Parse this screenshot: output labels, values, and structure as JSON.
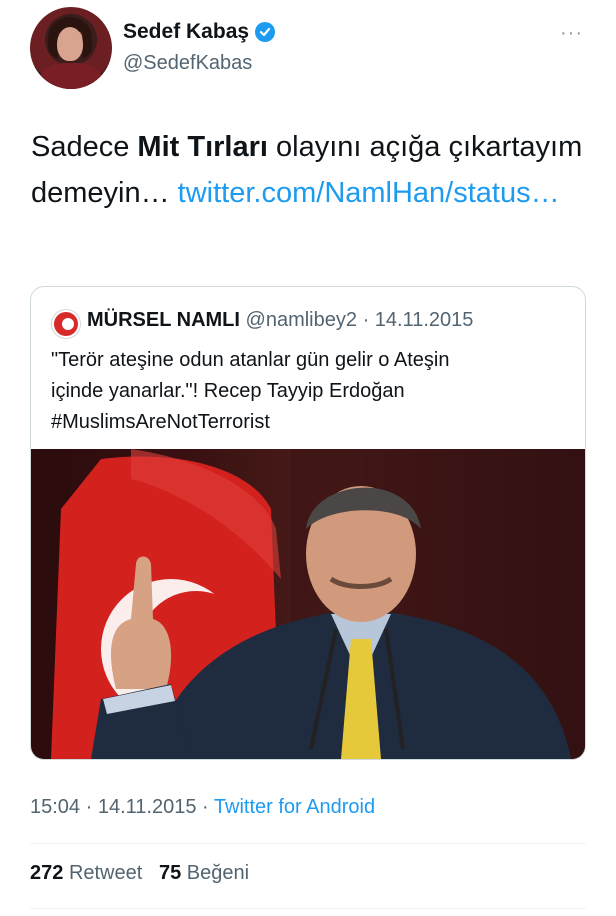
{
  "author": {
    "display_name": "Sedef Kabaş",
    "handle": "@SedefKabas",
    "more_label": "···"
  },
  "tweet": {
    "text_part1": "Sadece ",
    "text_bold": "Mit Tırları",
    "text_part2": " olayını açığa çıkartayım demeyin… ",
    "link_text": "twitter.com/NamlHan/status…"
  },
  "quoted": {
    "display_name": "MÜRSEL NAMLI",
    "handle": "@namlibey2",
    "separator": "·",
    "date": "14.11.2015",
    "text_line1": "\"Terör ateşine odun atanlar gün gelir o Ateşin",
    "text_line2": "içinde yanarlar.\"! Recep Tayyip Erdoğan",
    "text_line3": "#MuslimsAreNotTerrorist"
  },
  "meta": {
    "time": "15:04",
    "separator": "·",
    "date": "14.11.2015",
    "source": "Twitter for Android"
  },
  "stats": {
    "retweet_count": "272",
    "retweet_label": "Retweet",
    "like_count": "75",
    "like_label": "Beğeni"
  },
  "colors": {
    "link": "#1d9bf0",
    "secondary_text": "#536471",
    "primary_text": "#0f1419"
  }
}
